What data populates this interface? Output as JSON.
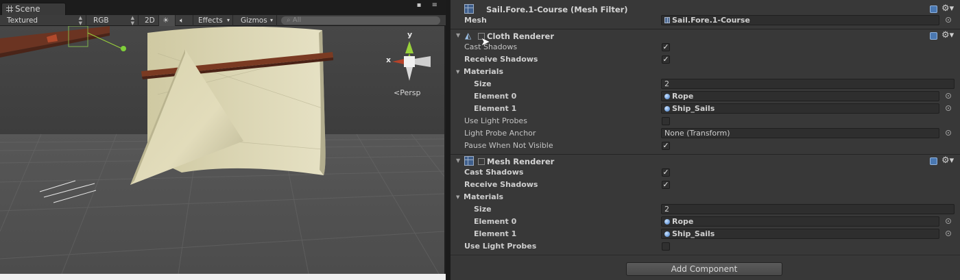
{
  "scene": {
    "tab_label": "Scene",
    "toolbar": {
      "shading": "Textured",
      "render_mode": "RGB",
      "mode_2d": "2D",
      "effects": "Effects",
      "gizmos": "Gizmos",
      "search_placeholder": "All"
    },
    "gizmo": {
      "y_label": "y",
      "x_label": "x",
      "projection": "Persp"
    }
  },
  "inspector": {
    "mesh_filter": {
      "title": "Sail.Fore.1-Course (Mesh Filter)",
      "mesh_label": "Mesh",
      "mesh_value": "Sail.Fore.1-Course"
    },
    "cloth_renderer": {
      "title": "Cloth Renderer",
      "cast_shadows_label": "Cast Shadows",
      "receive_shadows_label": "Receive Shadows",
      "materials_label": "Materials",
      "size_label": "Size",
      "size_value": "2",
      "element0_label": "Element 0",
      "element0_value": "Rope",
      "element1_label": "Element 1",
      "element1_value": "Ship_Sails",
      "use_light_probes_label": "Use Light Probes",
      "light_probe_anchor_label": "Light Probe Anchor",
      "light_probe_anchor_value": "None (Transform)",
      "pause_when_not_visible_label": "Pause When Not Visible",
      "cast_shadows": true,
      "receive_shadows": true,
      "use_light_probes": false,
      "pause_when_not_visible": true
    },
    "mesh_renderer": {
      "title": "Mesh Renderer",
      "cast_shadows_label": "Cast Shadows",
      "receive_shadows_label": "Receive Shadows",
      "materials_label": "Materials",
      "size_label": "Size",
      "size_value": "2",
      "element0_label": "Element 0",
      "element0_value": "Rope",
      "element1_label": "Element 1",
      "element1_value": "Ship_Sails",
      "use_light_probes_label": "Use Light Probes",
      "cast_shadows": true,
      "receive_shadows": true,
      "use_light_probes": false
    },
    "add_component_label": "Add Component"
  },
  "colors": {
    "inspector_bg": "#383838",
    "sail": "#dcd6b0",
    "mast": "#7a3a22",
    "gizmo_y": "#9ad23b",
    "gizmo_x": "#b5432a"
  }
}
